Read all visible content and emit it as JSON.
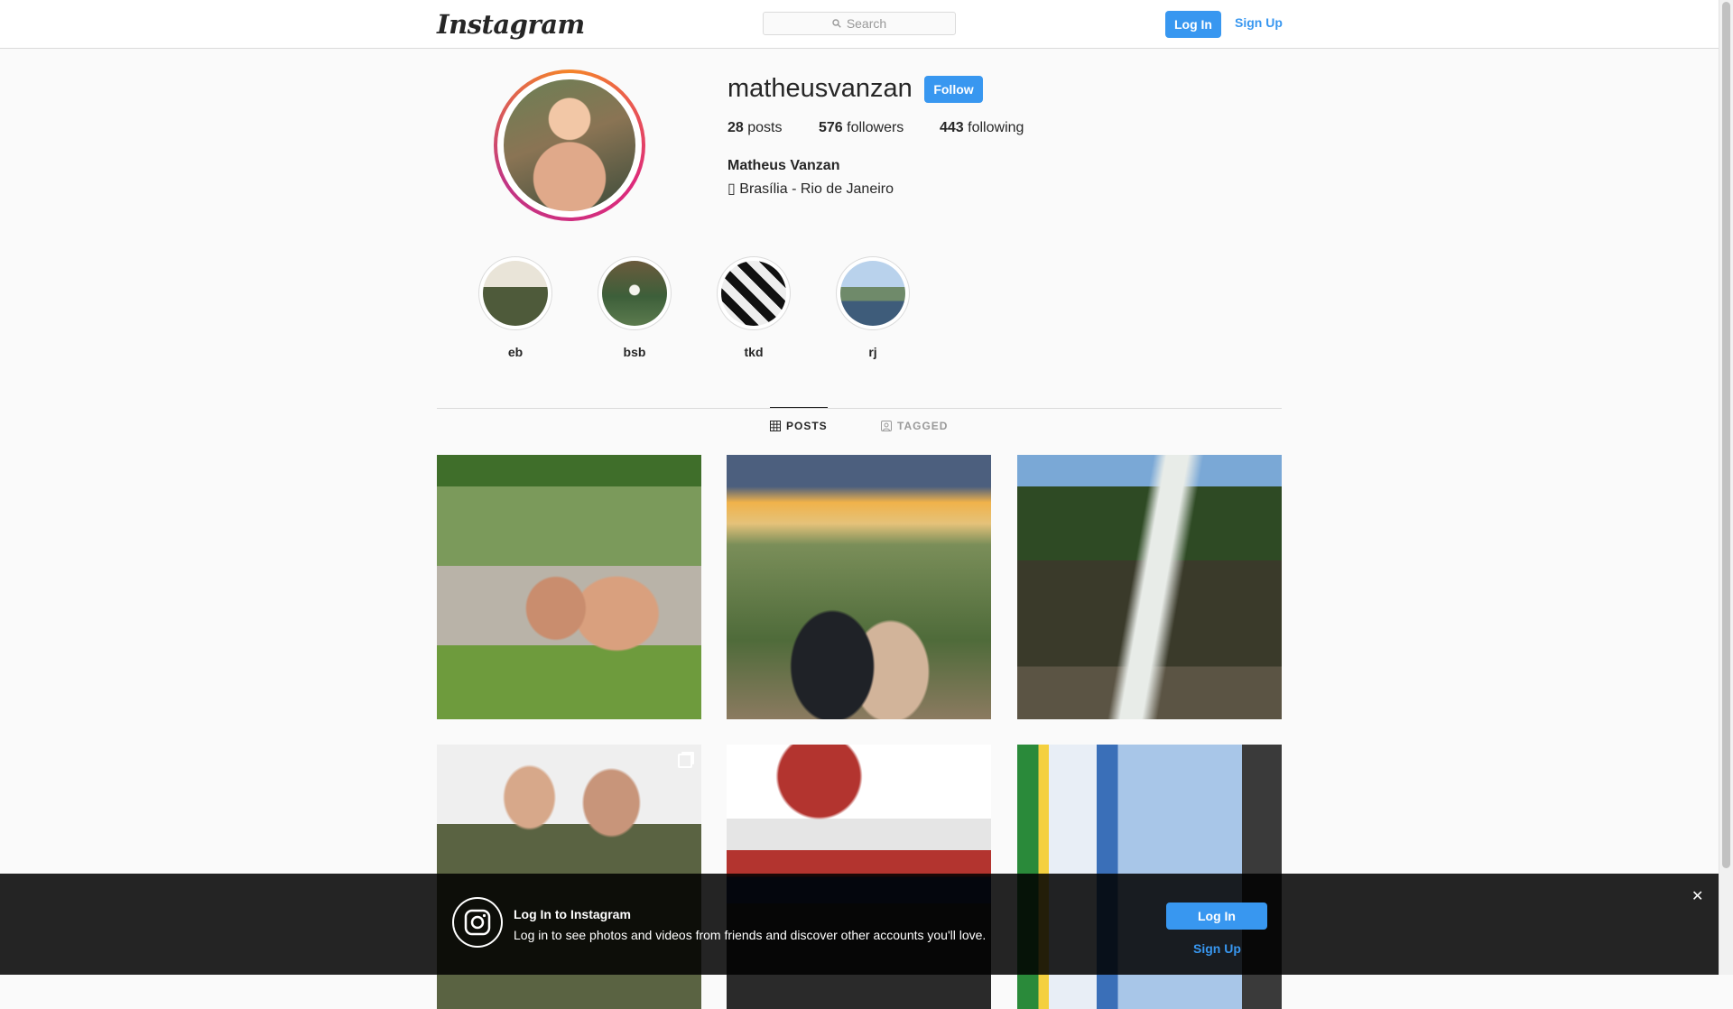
{
  "header": {
    "logo_text": "Instagram",
    "search_placeholder": "Search",
    "login_label": "Log In",
    "signup_label": "Sign Up"
  },
  "profile": {
    "username": "matheusvanzan",
    "follow_label": "Follow",
    "posts_count": "28",
    "posts_label": "posts",
    "followers_count": "576",
    "followers_label": "followers",
    "following_count": "443",
    "following_label": "following",
    "full_name": "Matheus Vanzan",
    "bio_icon": "▯",
    "bio": "Brasília - Rio de Janeiro"
  },
  "highlights": [
    {
      "label": "eb"
    },
    {
      "label": "bsb"
    },
    {
      "label": "tkd"
    },
    {
      "label": "rj"
    }
  ],
  "tabs": {
    "posts_label": "POSTS",
    "tagged_label": "TAGGED"
  },
  "banner": {
    "title": "Log In to Instagram",
    "text": "Log in to see photos and videos from friends and discover other accounts you'll love.",
    "login_label": "Log In",
    "signup_label": "Sign Up",
    "close_symbol": "✕"
  },
  "colors": {
    "accent": "#3897f0",
    "border": "#dbdbdb",
    "background": "#fafafa"
  }
}
